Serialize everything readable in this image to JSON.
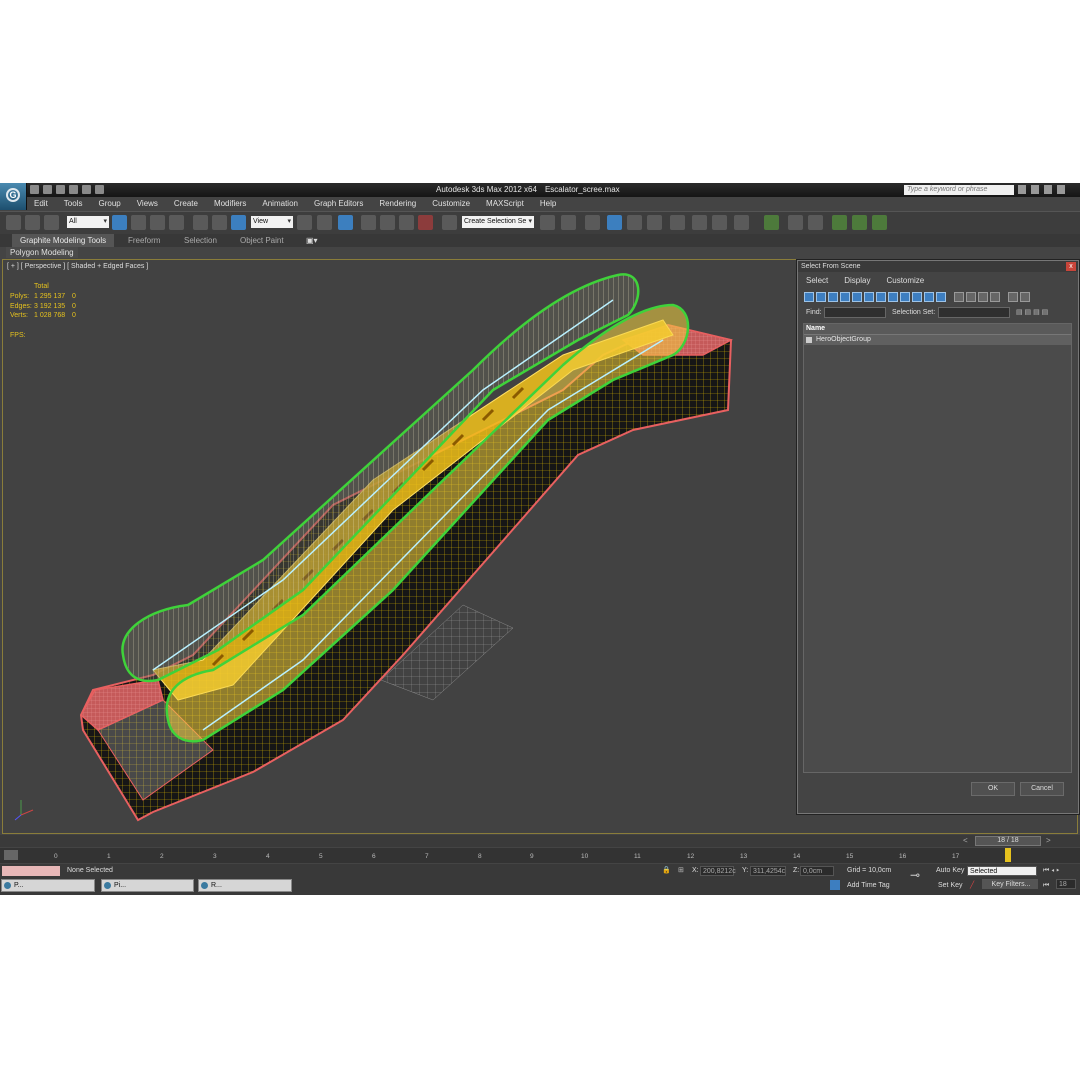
{
  "window": {
    "title": "Autodesk 3ds Max  2012 x64",
    "filename": "Escalator_scree.max",
    "search_placeholder": "Type a keyword or phrase"
  },
  "menu": [
    "Edit",
    "Tools",
    "Group",
    "Views",
    "Create",
    "Modifiers",
    "Animation",
    "Graph Editors",
    "Rendering",
    "Customize",
    "MAXScript",
    "Help"
  ],
  "toolbar": {
    "filter_value": "All",
    "coord_value": "View",
    "numbers": [
      "3",
      "%"
    ],
    "selection_set_placeholder": "Create Selection Se"
  },
  "ribbon": {
    "tabs": [
      "Graphite Modeling Tools",
      "Freeform",
      "Selection",
      "Object Paint"
    ],
    "panel": "Polygon Modeling"
  },
  "viewport": {
    "label": "[ + ] [ Perspective ] [ Shaded + Edged Faces ]",
    "stats_header": "Total",
    "stats": [
      {
        "key": "Polys:",
        "value": "1 295 137",
        "extra": "0"
      },
      {
        "key": "Edges:",
        "value": "3 192 135",
        "extra": "0"
      },
      {
        "key": "Verts:",
        "value": "1 028 768",
        "extra": "0"
      }
    ],
    "fps": "FPS:"
  },
  "dialog": {
    "title": "Select From Scene",
    "close": "x",
    "menu": [
      "Select",
      "Display",
      "Customize"
    ],
    "find_label": "Find:",
    "selection_set_label": "Selection Set:",
    "column_name": "Name",
    "items": [
      "HeroObjectGroup"
    ],
    "ok": "OK",
    "cancel": "Cancel"
  },
  "timeline": {
    "frame": "18 / 18",
    "left_arrow": "<",
    "right_arrow": ">",
    "ticks": [
      "0",
      "1",
      "2",
      "3",
      "4",
      "5",
      "6",
      "7",
      "8",
      "9",
      "10",
      "11",
      "12",
      "13",
      "14",
      "15",
      "16",
      "17"
    ]
  },
  "status": {
    "selection": "None Selected",
    "x_label": "X:",
    "x_value": "200,8212c",
    "y_label": "Y:",
    "y_value": "311,4254c",
    "z_label": "Z:",
    "z_value": "0,0cm",
    "grid": "Grid = 10,0cm",
    "add_time_tag": "Add Time Tag",
    "auto_key": "Auto Key",
    "auto_key_mode": "Selected",
    "set_key": "Set Key",
    "key_filters": "Key Filters...",
    "current_frame": "18"
  },
  "taskbar": [
    "P...",
    "Pi...",
    "R..."
  ],
  "colors": {
    "viewport_bg": "#424242",
    "stats_text": "#e6c21e",
    "selection_green": "#3fd23a",
    "mesh_red": "#e05a5a",
    "mesh_yellow": "#f2c21a"
  }
}
